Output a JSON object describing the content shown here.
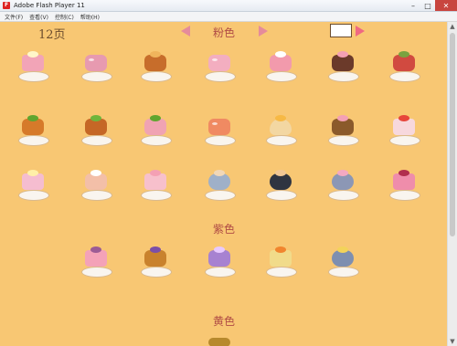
{
  "window": {
    "title": "Adobe Flash Player 11",
    "minimize": "–",
    "maximize": "□",
    "close": "✕"
  },
  "menu": [
    "文件(F)",
    "查看(V)",
    "控制(C)",
    "帮助(H)"
  ],
  "header": {
    "page_label": "12页",
    "category": "粉色"
  },
  "sections": [
    {
      "label": "紫色"
    },
    {
      "label": "黄色"
    }
  ],
  "colors": {
    "pink": "#f0a8b8",
    "purple": "#9e7ad1",
    "yellow": "#f2d85c",
    "orange": "#e58a3e",
    "brown": "#8b5a2b",
    "plate": "#f9f5ef"
  }
}
